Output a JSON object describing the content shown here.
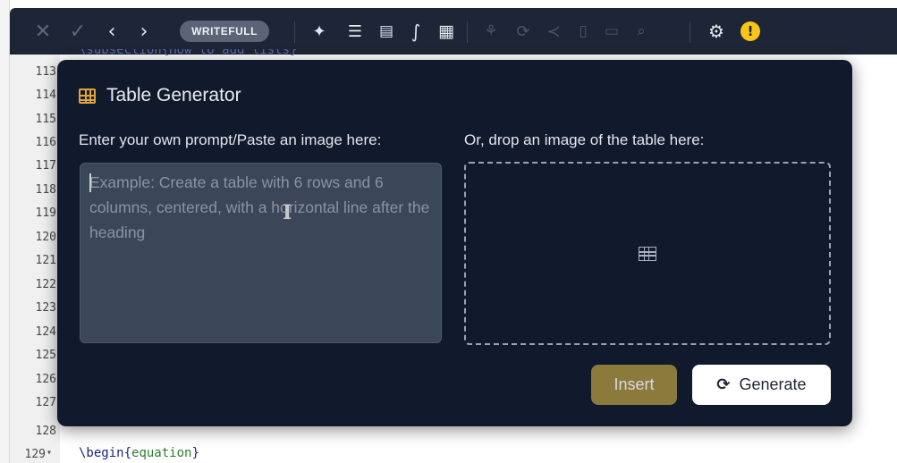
{
  "toolbar": {
    "writefull_label": "WRITEFULL",
    "icons": [
      "close-icon",
      "check-icon",
      "chevron-left-icon",
      "chevron-right-icon",
      "sparkle-icon",
      "equation-lines-icon",
      "note-icon",
      "integral-icon",
      "table-icon",
      "paraphrase-icon",
      "sync-icon",
      "share-icon",
      "clipboard-icon",
      "document-icon",
      "search-doc-icon",
      "gear-icon",
      "warning-icon"
    ],
    "warning_label": "!"
  },
  "editor": {
    "line_numbers": [
      "113",
      "114",
      "115",
      "116",
      "117",
      "118",
      "119",
      "120",
      "121",
      "122",
      "123",
      "124",
      "125",
      "126",
      "127",
      "128",
      "129"
    ],
    "last_line": {
      "number": "129",
      "fold": "▾",
      "command": "\\begin",
      "open": "{",
      "arg": "equation",
      "close": "}"
    }
  },
  "modal": {
    "title": "Table Generator",
    "prompt_label": "Enter your own prompt/Paste an image here:",
    "prompt_placeholder": "Example: Create a table with 6 rows and 6 columns, centered, with a horizontal line after the heading",
    "drop_label": "Or, drop an image of the table here:",
    "insert_label": "Insert",
    "generate_label": "Generate"
  },
  "colors": {
    "toolbar_bg": "#1d2536",
    "modal_bg": "#111a2c",
    "accent": "#e0a536",
    "insert_bg": "#8c7a3d",
    "warning": "#f5c518"
  }
}
